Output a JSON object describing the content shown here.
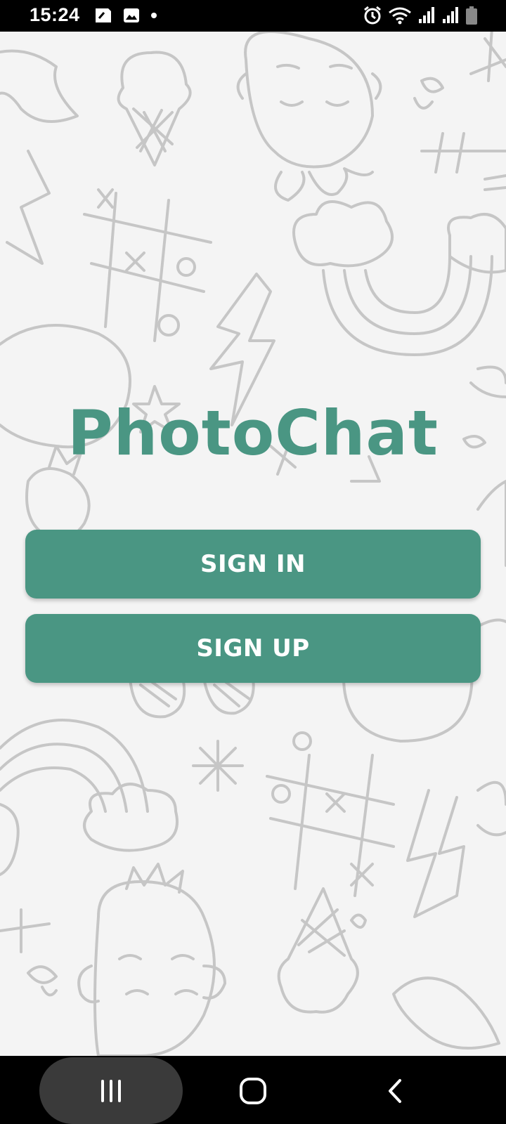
{
  "status_bar": {
    "time": "15:24",
    "left_icons": [
      "sim-card-icon",
      "image-icon",
      "dot-icon"
    ],
    "right_icons": [
      "alarm-icon",
      "wifi-icon",
      "signal-icon",
      "signal-icon",
      "battery-icon"
    ]
  },
  "app": {
    "title": "PhotoChat",
    "sign_in_label": "SIGN IN",
    "sign_up_label": "SIGN UP",
    "accent_color": "#4a9683",
    "background": "doodle-pattern"
  },
  "nav_bar": {
    "items": [
      "recents-icon",
      "home-icon",
      "back-icon"
    ]
  }
}
